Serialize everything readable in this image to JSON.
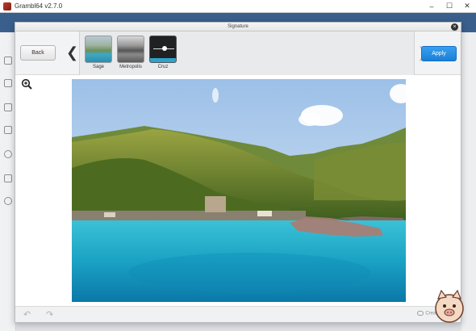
{
  "window": {
    "title": "Grambl64 v2.7.0",
    "controls": [
      "minimize",
      "maximize",
      "close"
    ]
  },
  "modal": {
    "title": "Signature",
    "close_label": "×"
  },
  "toolbar": {
    "back_label": "Back",
    "apply_label": "Apply",
    "filters": [
      {
        "label": "Sage"
      },
      {
        "label": "Metropolis"
      },
      {
        "label": "Cruz"
      }
    ]
  },
  "footer": {
    "credit": "Creative Cloud"
  },
  "icons": {
    "zoom": "zoom-in-icon",
    "undo": "undo-icon",
    "redo": "redo-icon",
    "prev": "chevron-left-icon",
    "next": "chevron-right-icon"
  },
  "colors": {
    "apply": "#1a7fd8",
    "cruz_active": "#2fa3c9"
  }
}
